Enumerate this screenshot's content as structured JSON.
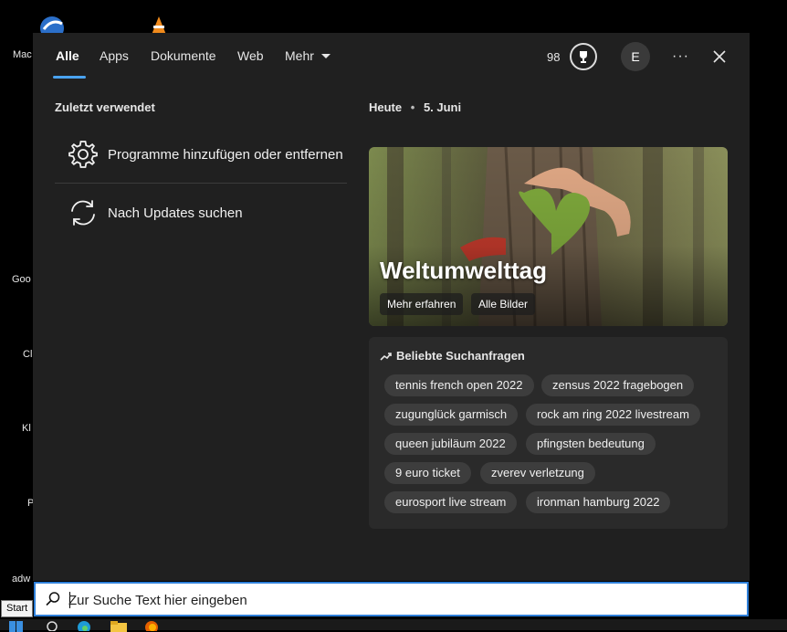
{
  "desktop": {
    "labels": [
      "Mac",
      "Goo",
      "Cl",
      "Kl",
      "P",
      "adw"
    ]
  },
  "tabs": [
    {
      "label": "Alle",
      "active": true
    },
    {
      "label": "Apps",
      "active": false
    },
    {
      "label": "Dokumente",
      "active": false
    },
    {
      "label": "Web",
      "active": false
    },
    {
      "label": "Mehr",
      "active": false
    }
  ],
  "header": {
    "points": "98",
    "avatar_initial": "E",
    "more_label": "···"
  },
  "recent": {
    "title": "Zuletzt verwendet",
    "items": [
      {
        "label": "Programme hinzufügen oder entfernen",
        "icon": "gear-icon"
      },
      {
        "label": "Nach Updates suchen",
        "icon": "sync-icon"
      }
    ]
  },
  "today": {
    "label": "Heute",
    "separator": "•",
    "date": "5. Juni"
  },
  "hero": {
    "title": "Weltumwelttag",
    "learn_more": "Mehr erfahren",
    "all_images": "Alle Bilder"
  },
  "popular": {
    "title": "Beliebte Suchanfragen",
    "chips": [
      "tennis french open 2022",
      "zensus 2022 fragebogen",
      "zugunglück garmisch",
      "rock am ring 2022 livestream",
      "queen jubiläum 2022",
      "pfingsten bedeutung",
      "9 euro ticket",
      "zverev verletzung",
      "eurosport live stream",
      "ironman hamburg 2022"
    ]
  },
  "search": {
    "placeholder": "Zur Suche Text hier eingeben"
  },
  "taskbar": {
    "start_tooltip": "Start"
  },
  "colors": {
    "accent": "#4aa3f0",
    "panel_bg": "#202020",
    "chip_bg": "#3d3d3d",
    "search_border": "#2e7fd9"
  }
}
